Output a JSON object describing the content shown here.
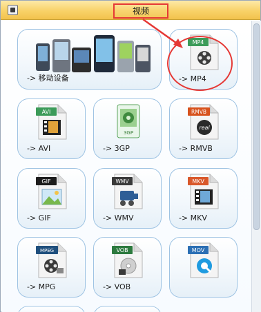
{
  "header": {
    "title": "视频",
    "icon": "film-icon"
  },
  "tiles": [
    {
      "label": "-> 移动设备",
      "icon": "mobile-devices-icon"
    },
    {
      "label": "-> MP4",
      "badge": "MP4",
      "icon": "mp4-file-icon",
      "badge_color": "#3c9b59"
    },
    {
      "label": "-> AVI",
      "badge": "AVI",
      "icon": "avi-file-icon",
      "badge_color": "#3c9b59"
    },
    {
      "label": "-> 3GP",
      "badge": "3GP",
      "icon": "3gp-file-icon",
      "badge_color": "#3c9b59"
    },
    {
      "label": "-> RMVB",
      "badge": "RMVB",
      "icon": "rmvb-file-icon",
      "badge_color": "#d7521d"
    },
    {
      "label": "-> GIF",
      "badge": "GIF",
      "icon": "gif-file-icon",
      "badge_color": "#1d1d1d"
    },
    {
      "label": "-> WMV",
      "badge": "WMV",
      "icon": "wmv-file-icon",
      "badge_color": "#3a3a3a"
    },
    {
      "label": "-> MKV",
      "badge": "MKV",
      "icon": "mkv-file-icon",
      "badge_color": "#d9582a"
    },
    {
      "label": "-> MPG",
      "badge": "MPEG",
      "icon": "mpeg-file-icon",
      "badge_color": "#1f4f7d"
    },
    {
      "label": "-> VOB",
      "badge": "VOB",
      "icon": "vob-file-icon",
      "badge_color": "#2d7a3f"
    },
    {
      "label": "",
      "badge": "MOV",
      "icon": "mov-file-icon",
      "badge_color": "#2b6fb4"
    }
  ]
}
